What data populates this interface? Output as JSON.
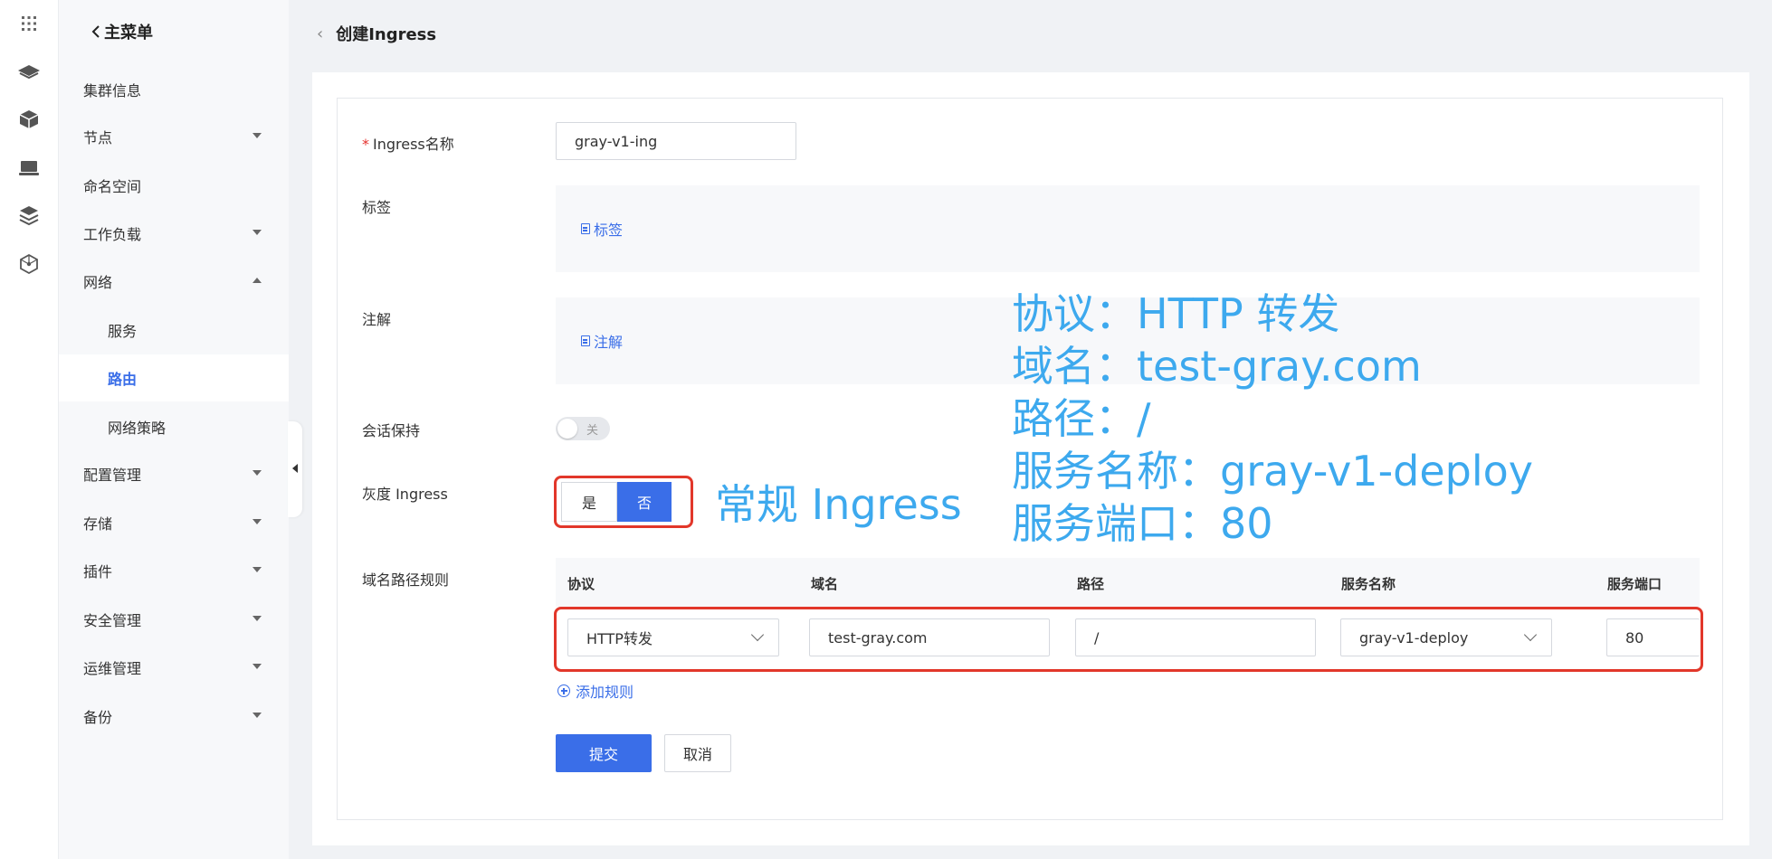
{
  "sidebar": {
    "back_label": "主菜单",
    "items": [
      {
        "label": "集群信息"
      },
      {
        "label": "节点"
      },
      {
        "label": "命名空间"
      },
      {
        "label": "工作负载"
      },
      {
        "label": "网络"
      },
      {
        "label": "服务"
      },
      {
        "label": "路由"
      },
      {
        "label": "网络策略"
      },
      {
        "label": "配置管理"
      },
      {
        "label": "存储"
      },
      {
        "label": "插件"
      },
      {
        "label": "安全管理"
      },
      {
        "label": "运维管理"
      },
      {
        "label": "备份"
      }
    ],
    "active_item": "路由"
  },
  "header": {
    "title": "创建Ingress"
  },
  "form": {
    "name_label": "Ingress名称",
    "name_value": "gray-v1-ing",
    "labels_label": "标签",
    "labels_link": "标签",
    "annotations_label": "注解",
    "annotations_link": "注解",
    "session_label": "会话保持",
    "session_toggle_text": "关",
    "gray_label": "灰度 Ingress",
    "gray_yes": "是",
    "gray_no": "否",
    "rules_label": "域名路径规则",
    "rules_columns": [
      "协议",
      "域名",
      "路径",
      "服务名称",
      "服务端口"
    ],
    "rule": {
      "protocol": "HTTP转发",
      "domain": "test-gray.com",
      "path": "/",
      "service_name": "gray-v1-deploy",
      "service_port": "80"
    },
    "add_rule": "添加规则",
    "submit": "提交",
    "cancel": "取消"
  },
  "annotations_overlay": {
    "gray_note": "常规 Ingress",
    "lines": [
      "协议：HTTP 转发",
      "域名：test-gray.com",
      "路径：/",
      "服务名称：gray-v1-deploy",
      "服务端口：80"
    ]
  },
  "colors": {
    "accent": "#3a6ee8",
    "highlight": "#e2372a",
    "annotation": "#3da9ee"
  }
}
